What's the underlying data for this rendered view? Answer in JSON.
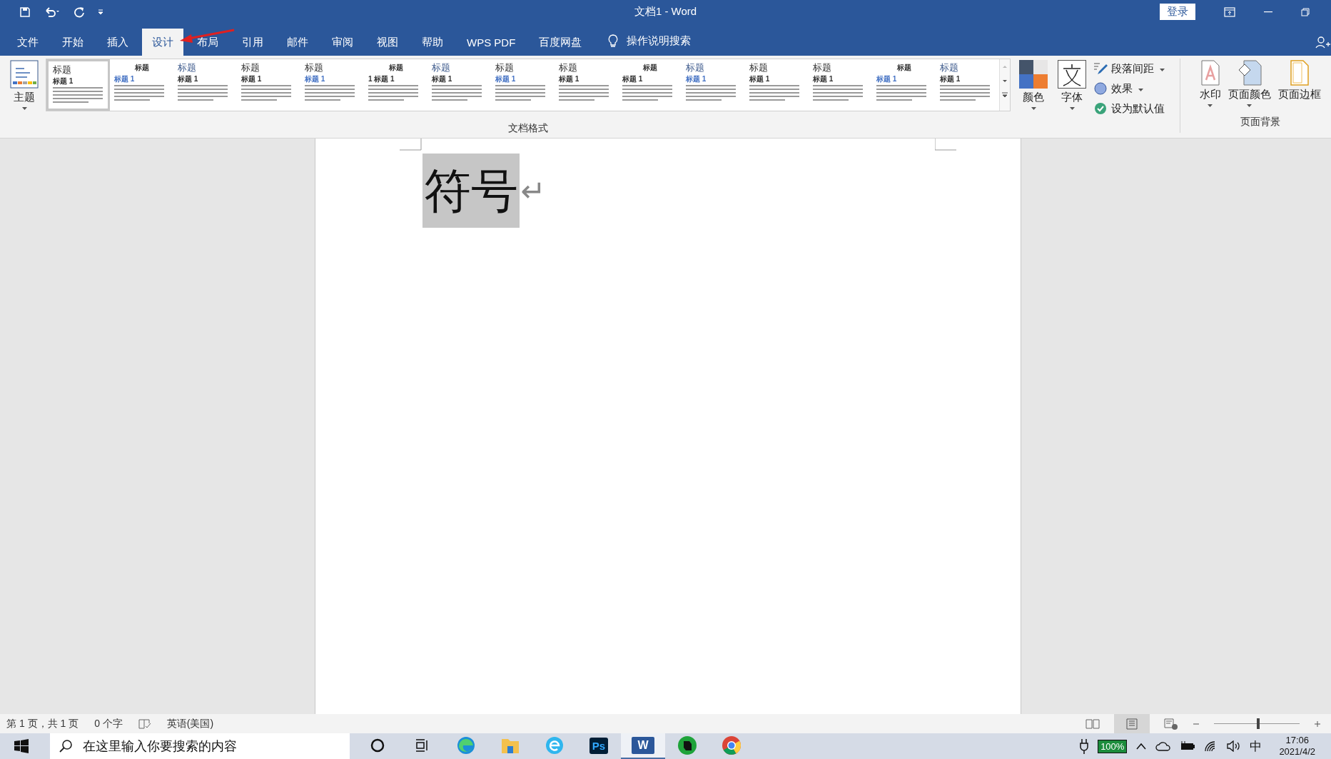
{
  "window": {
    "title": "文档1  -  Word",
    "sign_in": "登录"
  },
  "tabs": [
    {
      "label": "文件",
      "selected": false
    },
    {
      "label": "开始",
      "selected": false
    },
    {
      "label": "插入",
      "selected": false
    },
    {
      "label": "设计",
      "selected": true
    },
    {
      "label": "布局",
      "selected": false
    },
    {
      "label": "引用",
      "selected": false
    },
    {
      "label": "邮件",
      "selected": false
    },
    {
      "label": "审阅",
      "selected": false
    },
    {
      "label": "视图",
      "selected": false
    },
    {
      "label": "帮助",
      "selected": false
    },
    {
      "label": "WPS PDF",
      "selected": false
    },
    {
      "label": "百度网盘",
      "selected": false
    }
  ],
  "tell_me": "操作说明搜索",
  "ribbon": {
    "theme_button": "主题",
    "gallery": [
      {
        "title": "标题",
        "heading": "标题  1",
        "selected": true
      },
      {
        "title": "标题",
        "heading": "标题 1",
        "selected": false
      },
      {
        "title": "标题",
        "heading": "标题 1",
        "selected": false
      },
      {
        "title": "标题",
        "heading": "标题 1",
        "selected": false
      },
      {
        "title": "标题",
        "heading": "标题 1",
        "selected": false
      },
      {
        "title": "标题",
        "heading": "1  标题 1",
        "selected": false
      },
      {
        "title": "标题",
        "heading": "标题 1",
        "selected": false
      },
      {
        "title": "标题",
        "heading": "标题 1",
        "selected": false
      },
      {
        "title": "标题",
        "heading": "标题 1",
        "selected": false
      },
      {
        "title": "标题",
        "heading": "标题 1",
        "selected": false
      },
      {
        "title": "标题",
        "heading": "标题 1",
        "selected": false
      },
      {
        "title": "标题",
        "heading": "标题 1",
        "selected": false
      },
      {
        "title": "标题",
        "heading": "标题 1",
        "selected": false
      },
      {
        "title": "标题",
        "heading": "标题 1",
        "selected": false
      },
      {
        "title": "标题",
        "heading": "标题 1",
        "selected": false
      }
    ],
    "gallery_label": "文档格式",
    "colors": "颜色",
    "fonts": "字体",
    "paragraph_spacing": "段落间距",
    "effects": "效果",
    "set_default": "设为默认值",
    "watermark": "水印",
    "page_color": "页面颜色",
    "page_borders": "页面边框",
    "page_background_label": "页面背景"
  },
  "document": {
    "text": "符号",
    "paragraph_mark": "↵",
    "selected": true
  },
  "status_bar": {
    "page": "第 1 页，共 1 页",
    "words": "0 个字",
    "language": "英语(美国)",
    "zoom": {
      "level": 0.52
    }
  },
  "taskbar": {
    "search_placeholder": "在这里输入你要搜索的内容",
    "apps": [
      {
        "kind": "cortana",
        "active": false
      },
      {
        "kind": "taskview",
        "active": false
      },
      {
        "kind": "edge",
        "active": false
      },
      {
        "kind": "folder",
        "active": false
      },
      {
        "kind": "ie",
        "active": false
      },
      {
        "kind": "photoshop",
        "label": "Ps",
        "active": false
      },
      {
        "kind": "word",
        "label": "W",
        "active": true
      },
      {
        "kind": "evernote",
        "active": false
      },
      {
        "kind": "chrome",
        "active": false
      }
    ],
    "battery": "100%",
    "ime": "中",
    "time": "17:06",
    "date": "2021/4/2"
  }
}
